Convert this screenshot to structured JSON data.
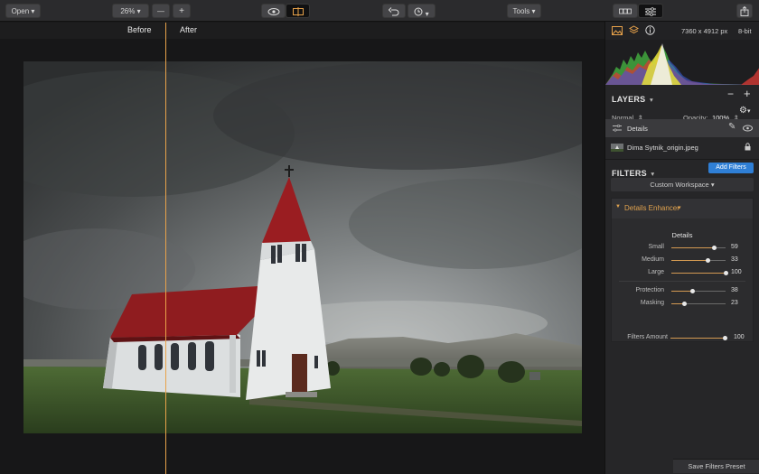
{
  "toolbar": {
    "open_label": "Open",
    "zoom_label": "26%",
    "zoom_out_label": "—",
    "zoom_in_label": "+",
    "tools_label": "Tools"
  },
  "compare": {
    "before_label": "Before",
    "after_label": "After",
    "divider_position": 0.274
  },
  "panel": {
    "image_info": "7360 x 4912 px",
    "bit_depth": "8-bit",
    "layers_title": "LAYERS",
    "blend_mode": "Normal",
    "opacity_label": "Opacity:",
    "opacity_value": "100%",
    "layers": [
      {
        "name": "Details"
      },
      {
        "name": "Dima Sytnik_origin.jpeg"
      }
    ],
    "filters_title": "FILTERS",
    "add_filters_label": "Add Filters",
    "workspace_label": "Custom Workspace",
    "filter_name": "Details Enhancer",
    "details_heading": "Details",
    "sliders": [
      {
        "label": "Small",
        "value": "59",
        "level": 0.79
      },
      {
        "label": "Medium",
        "value": "33",
        "level": 0.66
      },
      {
        "label": "Large",
        "value": "100",
        "level": 1.0
      },
      {
        "label": "Protection",
        "value": "38",
        "level": 0.38
      },
      {
        "label": "Masking",
        "value": "23",
        "level": 0.23
      }
    ],
    "filters_amount_label": "Filters Amount",
    "filters_amount_value": "100",
    "filters_amount_level": 1.0,
    "save_preset_label": "Save Filters Preset"
  },
  "colors": {
    "accent": "#e8a24a",
    "button_blue": "#2f7fd6",
    "filter_title": "#e0a24e"
  },
  "icons": [
    "eye-icon",
    "compare-icon",
    "undo-icon",
    "history-icon",
    "grid-icon",
    "adjust-icon",
    "share-icon",
    "image-icon",
    "layers-icon",
    "info-icon",
    "minus-icon",
    "plus-icon",
    "gear-icon",
    "brush-icon",
    "lock-icon"
  ]
}
